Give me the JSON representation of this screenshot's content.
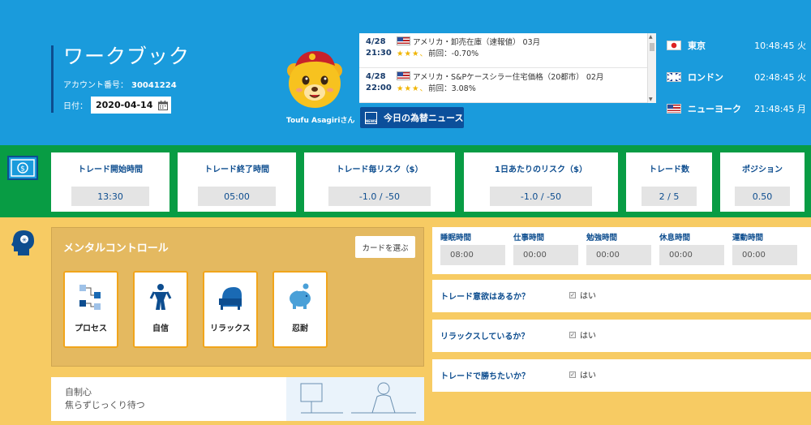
{
  "header": {
    "title": "ワークブック",
    "account_label": "アカウント番号：",
    "account_number": "30041224",
    "date_label": "日付：",
    "date_value": "2020-04-14",
    "mascot_name": "Toufu Asagiriさん",
    "news_button": "今日の為替ニュース"
  },
  "news": [
    {
      "date": "4/28",
      "time": "21:30",
      "title": "アメリカ・卸売在庫（速報値） 03月",
      "detail": "前回：-0.70%",
      "stars": "★★★、"
    },
    {
      "date": "4/28",
      "time": "22:00",
      "title": "アメリカ・S&Pケースシラー住宅価格（20都市） 02月",
      "detail": "前回：3.08%",
      "stars": "★★★、"
    }
  ],
  "clocks": [
    {
      "city": "東京",
      "time": "10:48:45 火",
      "flag": "jp"
    },
    {
      "city": "ロンドン",
      "time": "02:48:45 火",
      "flag": "uk"
    },
    {
      "city": "ニューヨーク",
      "time": "21:48:45 月",
      "flag": "us"
    }
  ],
  "stats": [
    {
      "label": "トレード開始時間",
      "value": "13:30"
    },
    {
      "label": "トレード終了時間",
      "value": "05:00"
    },
    {
      "label": "トレード毎リスク（$）",
      "value": "-1.0 / -50"
    },
    {
      "label": "1日あたりのリスク（$）",
      "value": "-1.0 / -50"
    },
    {
      "label": "トレード数",
      "value": "2 / 5"
    },
    {
      "label": "ポジション",
      "value": "0.50"
    }
  ],
  "mental": {
    "title": "メンタルコントロール",
    "pick_button": "カードを選ぶ",
    "cards": [
      "プロセス",
      "自信",
      "リラックス",
      "忍耐"
    ]
  },
  "quote": {
    "title": "自制心",
    "text": "焦らずじっくり待つ"
  },
  "sleep": [
    {
      "label": "睡眠時間",
      "value": "08:00"
    },
    {
      "label": "仕事時間",
      "value": "00:00"
    },
    {
      "label": "勉強時間",
      "value": "00:00"
    },
    {
      "label": "休息時間",
      "value": "00:00"
    },
    {
      "label": "運動時間",
      "value": "00:00"
    }
  ],
  "questions": [
    {
      "text": "トレード意欲はあるか？",
      "answer": "はい"
    },
    {
      "text": "リラックスしているか？",
      "answer": "はい"
    },
    {
      "text": "トレードで勝ちたいか？",
      "answer": "はい"
    }
  ],
  "colors": {
    "header_bg": "#1a9bdc",
    "stats_bg": "#089c44",
    "main_bg": "#f7cb63",
    "accent": "#0d4d8f",
    "card_border": "#f1a51b"
  }
}
